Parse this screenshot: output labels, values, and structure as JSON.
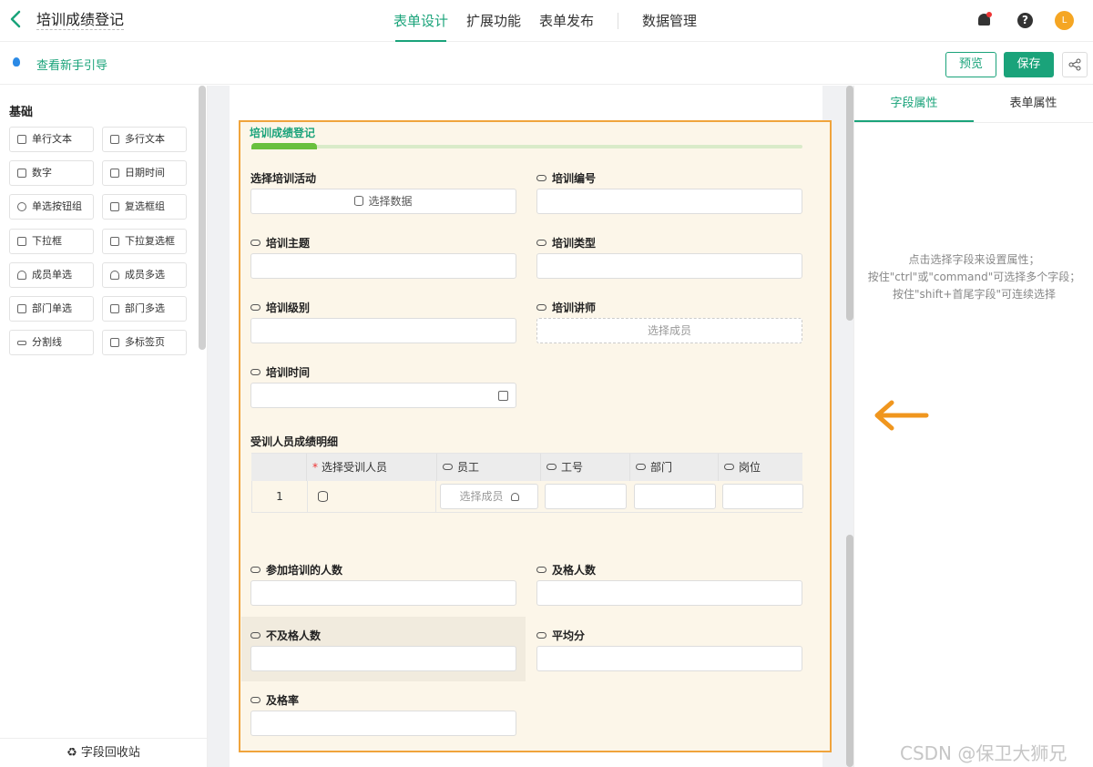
{
  "header": {
    "title": "培训成绩登记",
    "tabs": [
      {
        "label": "表单设计",
        "active": true
      },
      {
        "label": "扩展功能",
        "active": false
      },
      {
        "label": "表单发布",
        "active": false
      },
      {
        "label": "数据管理",
        "active": false
      }
    ],
    "avatar_text": "L"
  },
  "toolbar": {
    "guide_label": "查看新手引导",
    "preview_label": "预览",
    "save_label": "保存"
  },
  "sidebar": {
    "section_title": "基础",
    "components": [
      "单行文本",
      "多行文本",
      "数字",
      "日期时间",
      "单选按钮组",
      "复选框组",
      "下拉框",
      "下拉复选框",
      "成员单选",
      "成员多选",
      "部门单选",
      "部门多选",
      "分割线",
      "多标签页"
    ],
    "recycle_label": "字段回收站"
  },
  "form": {
    "title": "培训成绩登记",
    "fields": {
      "activity": {
        "label": "选择培训活动",
        "button": "选择数据"
      },
      "code": {
        "label": "培训编号"
      },
      "topic": {
        "label": "培训主题"
      },
      "type": {
        "label": "培训类型"
      },
      "level": {
        "label": "培训级别"
      },
      "lecturer": {
        "label": "培训讲师",
        "placeholder": "选择成员"
      },
      "time": {
        "label": "培训时间"
      },
      "participants": {
        "label": "参加培训的人数"
      },
      "passed": {
        "label": "及格人数"
      },
      "failed": {
        "label": "不及格人数"
      },
      "average": {
        "label": "平均分"
      },
      "pass_rate": {
        "label": "及格率"
      }
    },
    "subtable": {
      "title": "受训人员成绩明细",
      "columns": [
        "选择受训人员",
        "员工",
        "工号",
        "部门",
        "岗位"
      ],
      "rows": [
        {
          "index": "1",
          "employee_placeholder": "选择成员"
        }
      ]
    }
  },
  "rightpanel": {
    "tabs": [
      {
        "label": "字段属性",
        "active": true
      },
      {
        "label": "表单属性",
        "active": false
      }
    ],
    "tips": [
      "点击选择字段来设置属性；",
      "按住\"ctrl\"或\"command\"可选择多个字段；",
      "按住\"shift+首尾字段\"可连续选择"
    ]
  },
  "watermark": "CSDN @保卫大狮兄",
  "colors": {
    "accent": "#1aa37a",
    "highlight_border": "#f0a43c",
    "arrow": "#f0961e"
  }
}
